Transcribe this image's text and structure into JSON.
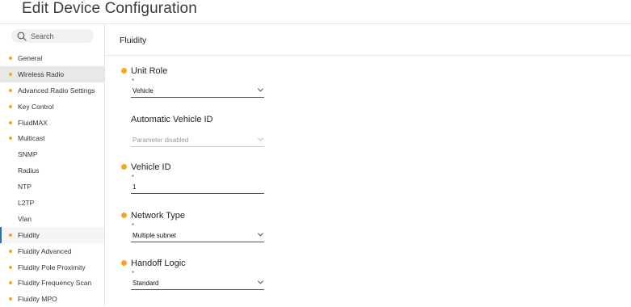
{
  "page": {
    "title": "Edit Device Configuration"
  },
  "search": {
    "placeholder": "Search"
  },
  "sidebar": {
    "items": [
      {
        "label": "General",
        "dot": true
      },
      {
        "label": "Wireless Radio",
        "dot": true,
        "state": "selected"
      },
      {
        "label": "Advanced Radio Settings",
        "dot": true
      },
      {
        "label": "Key Control",
        "dot": true
      },
      {
        "label": "FluidMAX",
        "dot": true
      },
      {
        "label": "Multicast",
        "dot": true
      },
      {
        "label": "SNMP",
        "dot": false
      },
      {
        "label": "Radius",
        "dot": false
      },
      {
        "label": "NTP",
        "dot": false
      },
      {
        "label": "L2TP",
        "dot": false
      },
      {
        "label": "Vlan",
        "dot": false
      },
      {
        "label": "Fluidity",
        "dot": true,
        "state": "active"
      },
      {
        "label": "Fluidity Advanced",
        "dot": true
      },
      {
        "label": "Fluidity Pole Proximity",
        "dot": true
      },
      {
        "label": "Fluidity Frequency Scan",
        "dot": true
      },
      {
        "label": "Fluidity MPO",
        "dot": true
      }
    ]
  },
  "main": {
    "section_title": "Fluidity",
    "fields": {
      "unit_role": {
        "label": "Unit Role",
        "required_mark": "*",
        "value": "Vehicle"
      },
      "automatic_vehicle_id": {
        "label": "Automatic Vehicle ID",
        "value": "Parameter disabled"
      },
      "vehicle_id": {
        "label": "Vehicle ID",
        "required_mark": "*",
        "value": "1"
      },
      "network_type": {
        "label": "Network Type",
        "required_mark": "*",
        "value": "Multiple subnet"
      },
      "handoff_logic": {
        "label": "Handoff Logic",
        "required_mark": "*",
        "value": "Standard"
      }
    }
  },
  "colors": {
    "accent_dot": "#f5a623",
    "active_bar": "#1a73c8",
    "selected_bg": "#e8e8e8"
  }
}
